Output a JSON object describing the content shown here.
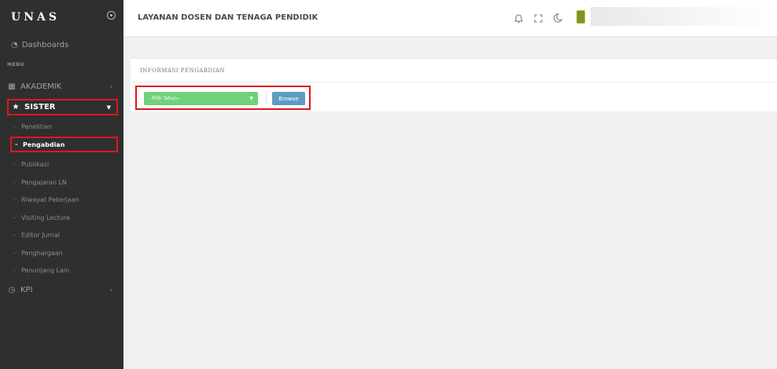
{
  "sidebar": {
    "brand": "UNAS",
    "dashboards_label": "Dashboards",
    "menu_heading": "MENU",
    "akademik_label": "AKADEMIK",
    "sister_label": "SISTER",
    "kpi_label": "KPI",
    "sister_items": [
      "Penelitian",
      "Pengabdian",
      "Publikasi",
      "Pengajaran LN",
      "Riwayat Pekerjaan",
      "Visiting Lecture",
      "Editor Jurnal",
      "Penghargaan",
      "Penunjang Lain"
    ],
    "active_item": "Pengabdian"
  },
  "header": {
    "title": "LAYANAN DOSEN DAN TENAGA PENDIDIK"
  },
  "card": {
    "title": "INFORMASI PENGABDIAN",
    "select_placeholder": "--Pilih Tahun--",
    "browse_label": "Browse"
  },
  "colors": {
    "sidebar_bg": "#2d302f",
    "highlight_border": "#e0161d",
    "select_green": "#6fd179",
    "browse_blue": "#5c9dc4"
  }
}
